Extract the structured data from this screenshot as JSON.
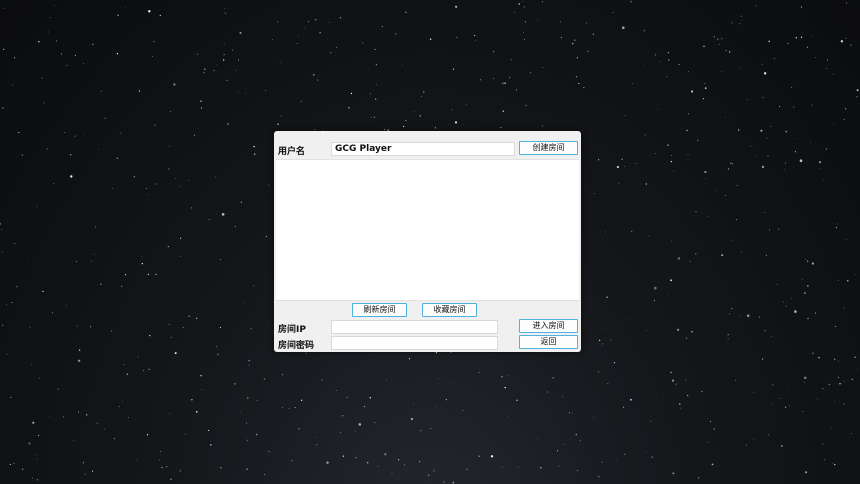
{
  "dialog": {
    "username_label": "用户名",
    "username_value": "GCG Player",
    "create_room_label": "创建房间",
    "room_list": [],
    "refresh_room_label": "刷新房间",
    "favorite_room_label": "收藏房间",
    "room_ip_label": "房间IP",
    "room_ip_value": "",
    "room_password_label": "房间密码",
    "room_password_value": "",
    "join_room_label": "进入房间",
    "back_label": "返回"
  },
  "colors": {
    "button_border": "#4fb1dd",
    "dialog_background": "#f0f0f0"
  }
}
